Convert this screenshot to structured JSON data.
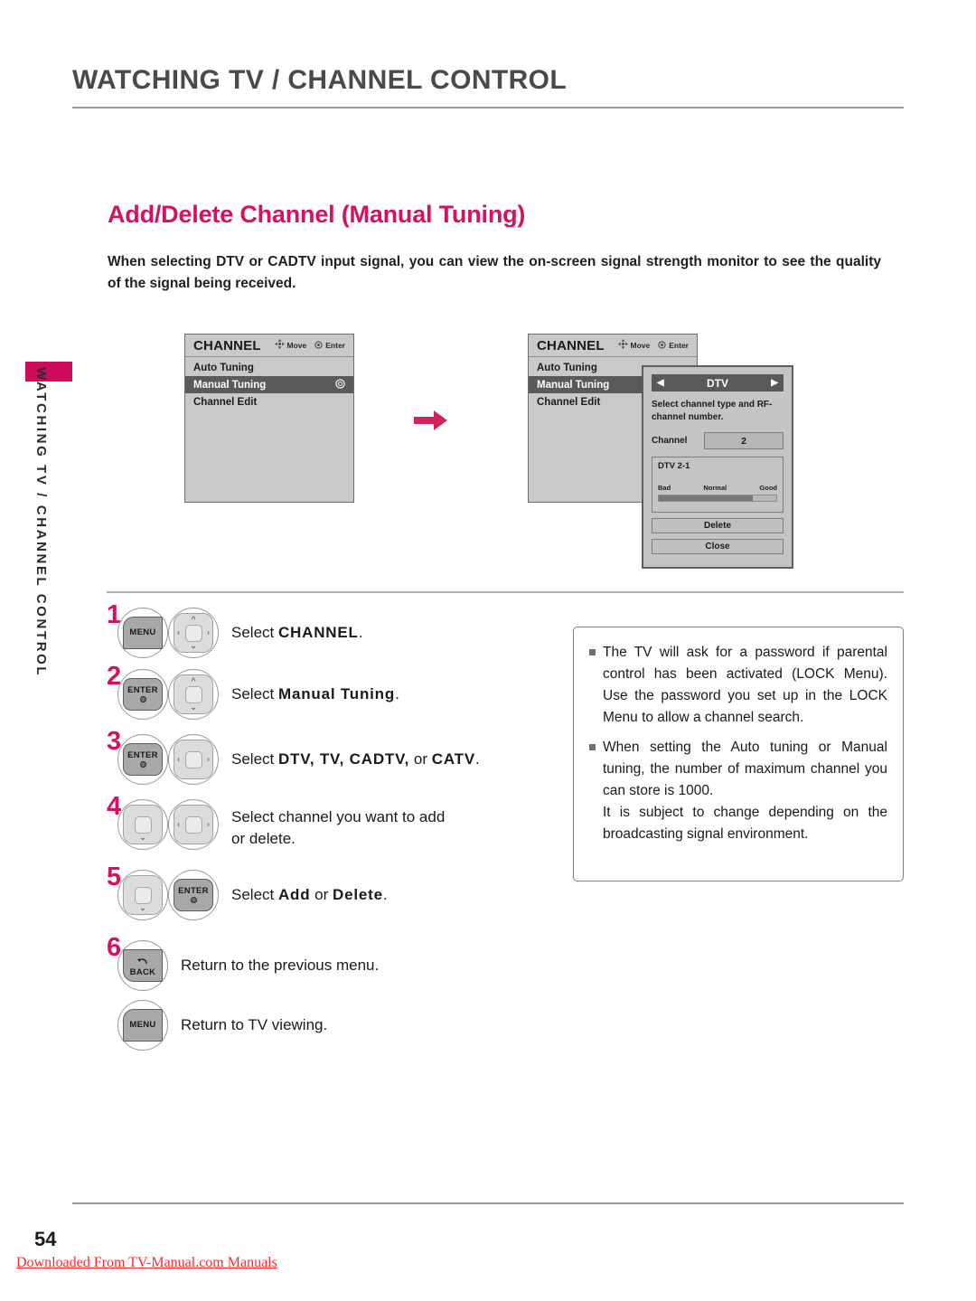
{
  "header": {
    "title": "WATCHING TV / CHANNEL CONTROL"
  },
  "side_tab": {
    "text": "WATCHING TV / CHANNEL CONTROL",
    "color": "#cf0b5b"
  },
  "section": {
    "title": "Add/Delete Channel (Manual Tuning)",
    "title_color": "#d4125f",
    "description": "When selecting DTV or CADTV input signal, you can view the on-screen signal strength monitor to see the quality of the signal being received."
  },
  "osd_menu": {
    "title": "CHANNEL",
    "hints": [
      {
        "icon": "dpad-move-icon",
        "label": "Move"
      },
      {
        "icon": "enter-circle-icon",
        "label": "Enter"
      }
    ],
    "items": [
      {
        "label": "Auto Tuning",
        "selected": false
      },
      {
        "label": "Manual Tuning",
        "selected": true
      },
      {
        "label": "Channel Edit",
        "selected": false
      }
    ]
  },
  "dtv_dialog": {
    "left_arrow": "◀",
    "type_label": "DTV",
    "right_arrow": "▶",
    "instruction": "Select channel type and RF-channel number.",
    "channel_label": "Channel",
    "channel_value": "2",
    "signal_name": "DTV 2-1",
    "scale": {
      "low": "Bad",
      "mid": "Normal",
      "high": "Good"
    },
    "signal_percent": 80,
    "buttons": [
      {
        "label": "Delete"
      },
      {
        "label": "Close"
      }
    ]
  },
  "flow_arrow": {
    "color": "#cf2458"
  },
  "steps": [
    {
      "num": "1",
      "keys": [
        {
          "type": "button",
          "label": "MENU",
          "shape": "tl",
          "dot": false
        },
        {
          "type": "nav",
          "arrows": [
            "up",
            "down",
            "left",
            "right"
          ]
        }
      ],
      "text_prefix": "Select ",
      "text_bold": "CHANNEL",
      "text_suffix": "."
    },
    {
      "num": "2",
      "keys": [
        {
          "type": "button",
          "label": "ENTER",
          "shape": "rr",
          "dot": true
        },
        {
          "type": "nav",
          "arrows": [
            "up",
            "down"
          ]
        }
      ],
      "text_prefix": "Select ",
      "text_bold": "Manual Tuning",
      "text_suffix": "."
    },
    {
      "num": "3",
      "keys": [
        {
          "type": "button",
          "label": "ENTER",
          "shape": "rr",
          "dot": true
        },
        {
          "type": "nav",
          "arrows": [
            "left",
            "right"
          ]
        }
      ],
      "text_prefix": "Select ",
      "text_bold": "DTV, TV, CADTV,",
      "text_mid": " or ",
      "text_bold2": "CATV",
      "text_suffix": "."
    },
    {
      "num": "4",
      "keys": [
        {
          "type": "nav",
          "arrows": [
            "down"
          ]
        },
        {
          "type": "nav",
          "arrows": [
            "left",
            "right"
          ]
        }
      ],
      "text_plain": "Select channel you want to add or delete."
    },
    {
      "num": "5",
      "keys": [
        {
          "type": "nav",
          "arrows": [
            "down"
          ]
        },
        {
          "type": "button",
          "label": "ENTER",
          "shape": "rr",
          "dot": true
        }
      ],
      "text_prefix": "Select ",
      "text_bold": "Add",
      "text_mid": " or ",
      "text_bold2": "Delete",
      "text_suffix": "."
    },
    {
      "num": "6",
      "keys": [
        {
          "type": "button",
          "label": "BACK",
          "shape": "bl",
          "dot": false,
          "glyph": "back-arrow-icon"
        }
      ],
      "text_plain": "Return to the previous menu."
    },
    {
      "num": "",
      "keys": [
        {
          "type": "button",
          "label": "MENU",
          "shape": "tl",
          "dot": false
        }
      ],
      "text_plain": "Return to TV viewing."
    }
  ],
  "notes": [
    {
      "text": "The TV will ask for a password if parental control has been activated (LOCK Menu). Use the password you set up in the LOCK Menu to allow a channel search."
    },
    {
      "text": "When setting the Auto tuning or Manual tuning, the number of maximum channel you can store is 1000.",
      "sub": "It is subject to change depending on the broadcasting signal environment."
    }
  ],
  "footer": {
    "page_number": "54",
    "download_note": "Downloaded From TV-Manual.com Manuals"
  }
}
